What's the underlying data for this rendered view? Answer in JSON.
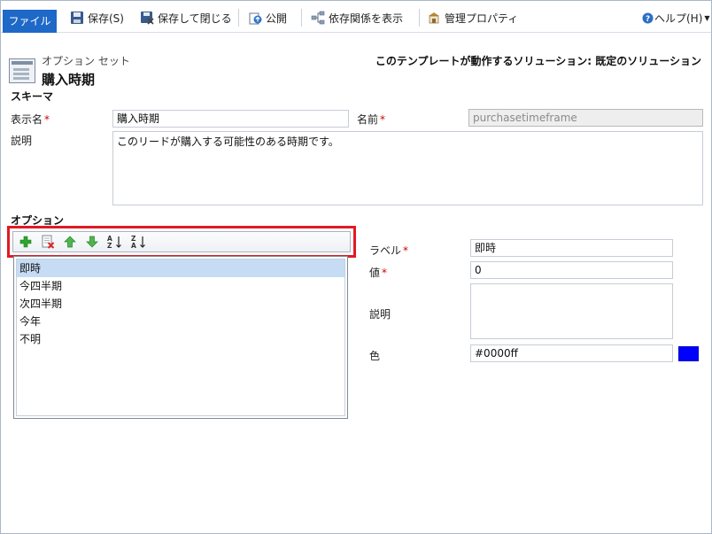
{
  "ribbon": {
    "file_label": "ファイル",
    "save_label": "保存(S)",
    "save_close_label": "保存して閉じる",
    "publish_label": "公開",
    "dependencies_label": "依存関係を表示",
    "managed_props_label": "管理プロパティ",
    "help_label": "ヘルプ(H)"
  },
  "header": {
    "entity_type": "オプション セット",
    "entity_name": "購入時期",
    "solution_text": "このテンプレートが動作するソリューション: 既定のソリューション"
  },
  "schema": {
    "section_title": "スキーマ",
    "display_name_label": "表示名",
    "display_name_value": "購入時期",
    "name_label": "名前",
    "name_value": "purchasetimeframe",
    "description_label": "説明",
    "description_value": "このリードが購入する可能性のある時期です。"
  },
  "options": {
    "section_title": "オプション",
    "items": [
      "即時",
      "今四半期",
      "次四半期",
      "今年",
      "不明"
    ],
    "selected_index": 0,
    "detail": {
      "label_label": "ラベル",
      "label_value": "即時",
      "value_label": "値",
      "value_value": "0",
      "description_label": "説明",
      "description_value": "",
      "color_label": "色",
      "color_value": "#0000ff"
    }
  },
  "required_mark": "*",
  "colors": {
    "accent_tab": "#1e68c8",
    "highlight_border": "#e01a22",
    "selected_row": "#c6dcf5",
    "swatch": "#0000ff"
  }
}
